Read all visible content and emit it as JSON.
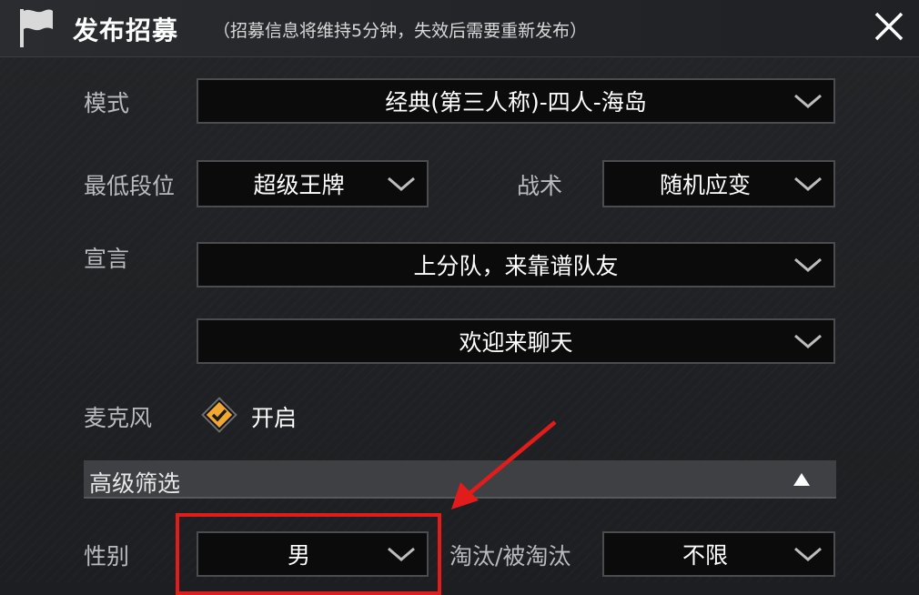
{
  "header": {
    "title": "发布招募",
    "subtitle": "（招募信息将维持5分钟，失效后需要重新发布）"
  },
  "form": {
    "mode": {
      "label": "模式",
      "value": "经典(第三人称)-四人-海岛"
    },
    "min_rank": {
      "label": "最低段位",
      "value": "超级王牌"
    },
    "tactic": {
      "label": "战术",
      "value": "随机应变"
    },
    "declaration": {
      "label": "宣言",
      "value1": "上分队，来靠谱队友",
      "value2": "欢迎来聊天"
    },
    "microphone": {
      "label": "麦克风",
      "value": "开启",
      "checked": true
    },
    "advanced": {
      "label": "高级筛选",
      "expanded": true
    },
    "gender": {
      "label": "性别",
      "value": "男"
    },
    "elimination": {
      "label": "淘汰/被淘汰",
      "value": "不限"
    }
  },
  "colors": {
    "accent_orange": "#f0a830",
    "annotation_red": "#e21b1b",
    "dropdown_bg": "#0b0b0c"
  },
  "icons": {
    "header": "flag-icon",
    "close": "close-icon",
    "dropdown": "chevron-down-icon",
    "advanced": "triangle-up-icon",
    "mic": "check-diamond-icon"
  }
}
